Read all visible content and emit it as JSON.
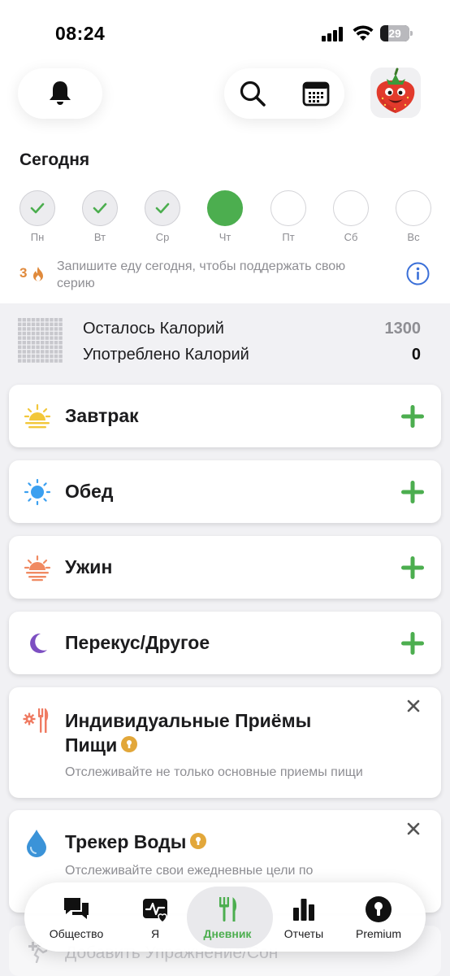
{
  "status_bar": {
    "time": "08:24",
    "battery": "29",
    "battery_level": 0.29
  },
  "header": {
    "title": "Сегодня"
  },
  "week": [
    {
      "label": "Пн",
      "state": "done"
    },
    {
      "label": "Вт",
      "state": "done"
    },
    {
      "label": "Ср",
      "state": "done"
    },
    {
      "label": "Чт",
      "state": "active"
    },
    {
      "label": "Пт",
      "state": "empty"
    },
    {
      "label": "Сб",
      "state": "empty"
    },
    {
      "label": "Вс",
      "state": "empty"
    }
  ],
  "streak": {
    "count": "3",
    "text": "Запишите еду сегодня, чтобы поддержать свою серию"
  },
  "calories": {
    "remaining_label": "Осталось Калорий",
    "remaining_value": "1300",
    "consumed_label": "Употреблено Калорий",
    "consumed_value": "0"
  },
  "meals": [
    {
      "label": "Завтрак",
      "icon": "sunrise-icon"
    },
    {
      "label": "Обед",
      "icon": "sun-icon"
    },
    {
      "label": "Ужин",
      "icon": "sunset-icon"
    },
    {
      "label": "Перекус/Другое",
      "icon": "moon-icon"
    }
  ],
  "promos": {
    "custom_meals": {
      "title_line1": "Индивидуальные Приёмы",
      "title_line2": "Пищи",
      "description": "Отслеживайте не только основные приемы пищи"
    },
    "water": {
      "title": "Трекер Воды",
      "description": "Отслеживайте свои ежедневные цели по"
    }
  },
  "ghost_row": {
    "label": "Добавить Упражнение/Сон"
  },
  "nav": [
    {
      "label": "Общество",
      "icon": "chat-icon"
    },
    {
      "label": "Я",
      "icon": "heart-activity-icon"
    },
    {
      "label": "Дневник",
      "icon": "fork-knife-icon",
      "active": true
    },
    {
      "label": "Отчеты",
      "icon": "bar-chart-icon"
    },
    {
      "label": "Premium",
      "icon": "keyhole-icon"
    }
  ],
  "colors": {
    "accent_green": "#4cae4f",
    "streak_orange": "#e08a3c",
    "info_blue": "#3a6fd8",
    "lock_gold": "#e2a73a"
  }
}
